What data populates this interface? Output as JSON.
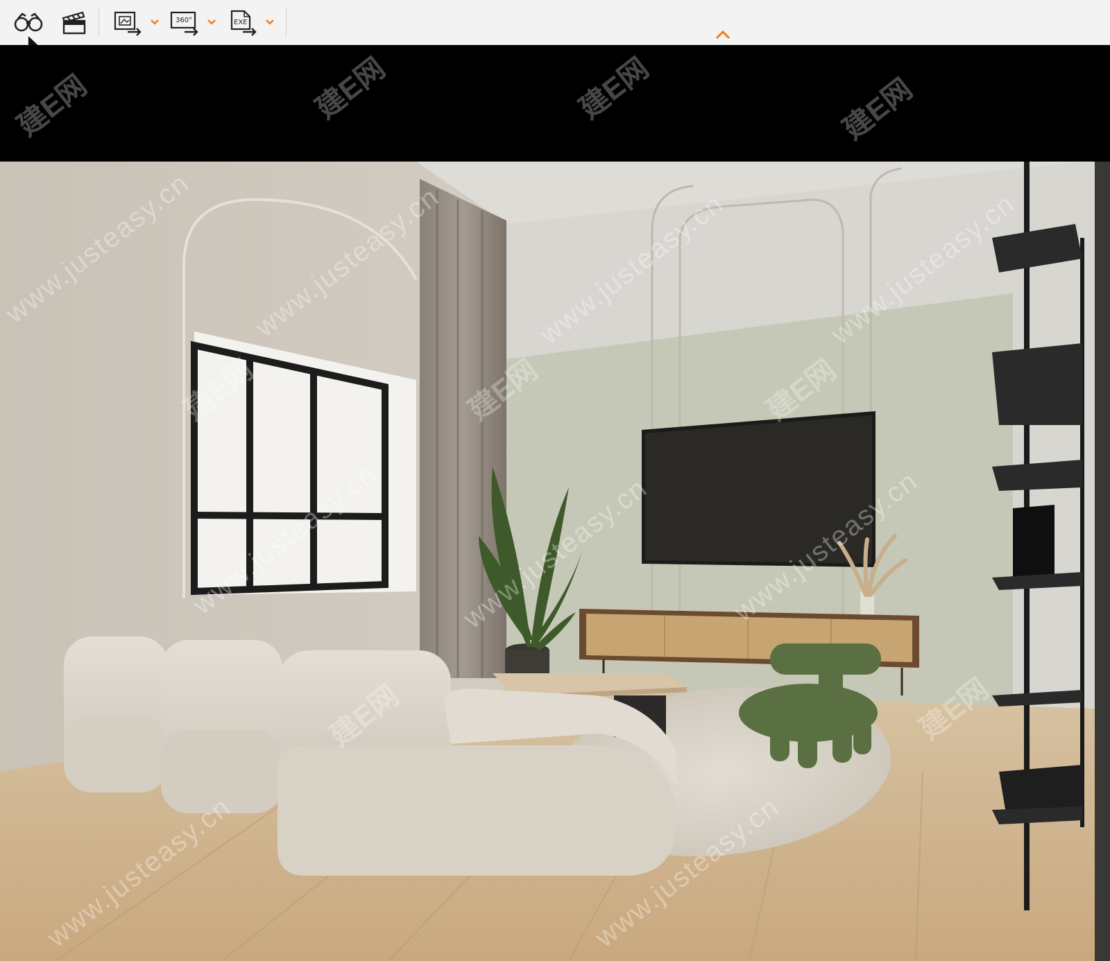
{
  "toolbar": {
    "buttons": [
      {
        "name": "panorama-view",
        "icon": "binoculars-icon"
      },
      {
        "name": "animation",
        "icon": "clapperboard-icon"
      },
      {
        "name": "export-images",
        "icon": "image-export-icon"
      },
      {
        "name": "export-360",
        "icon": "panorama-360-export-icon",
        "text": "360°"
      },
      {
        "name": "export-exe",
        "icon": "exe-export-icon",
        "text": "EXE"
      }
    ],
    "accent_color": "#f07c1c"
  },
  "watermarks": {
    "url_text": "www.justeasy.cn",
    "logo_text": "建E网"
  },
  "scene": {
    "description_colors": {
      "wall": "#cdc6bb",
      "accent_wall": "#bcc0ae",
      "floor": "#c9ab83",
      "sofa": "#ddd6cc",
      "chair": "#5b7042",
      "tv": "#1c1b19"
    }
  }
}
